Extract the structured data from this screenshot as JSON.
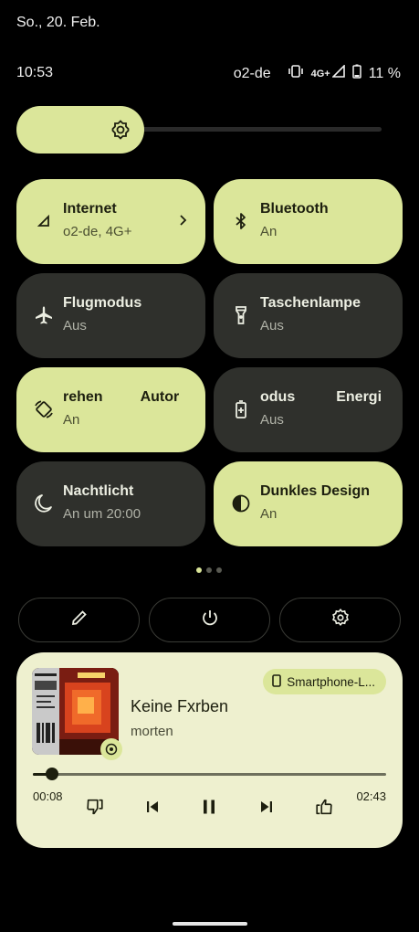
{
  "status_bar": {
    "date": "So., 20. Feb.",
    "time": "10:53",
    "carrier": "o2-de",
    "network": "4G+",
    "battery": "11 %"
  },
  "brightness": {
    "level": 0.35,
    "icon": "brightness-icon"
  },
  "tiles": [
    {
      "title": "Internet",
      "subtitle": "o2-de, 4G+",
      "state": "on",
      "icon": "signal-icon",
      "has_chevron": true
    },
    {
      "title": "Bluetooth",
      "subtitle": "An",
      "state": "on",
      "icon": "bluetooth-icon"
    },
    {
      "title": "Flugmodus",
      "subtitle": "Aus",
      "state": "off",
      "icon": "airplane-icon"
    },
    {
      "title": "Taschenlampe",
      "subtitle": "Aus",
      "state": "off",
      "icon": "flashlight-icon"
    },
    {
      "title": "Automatisch drehen",
      "title_visible_a": "rehen",
      "title_visible_b": "Autor",
      "subtitle": "An",
      "state": "on",
      "icon": "auto-rotate-icon"
    },
    {
      "title": "Energiesparmodus",
      "title_visible_a": "odus",
      "title_visible_b": "Energi",
      "subtitle": "Aus",
      "state": "off",
      "icon": "battery-saver-icon"
    },
    {
      "title": "Nachtlicht",
      "subtitle": "An um 20:00",
      "state": "off",
      "icon": "moon-icon"
    },
    {
      "title": "Dunkles Design",
      "subtitle": "An",
      "state": "on",
      "icon": "contrast-icon"
    }
  ],
  "page_indicator": {
    "pages": 3,
    "current": 1
  },
  "footer_buttons": [
    "edit-icon",
    "power-icon",
    "settings-icon"
  ],
  "media": {
    "device": "Smartphone-L...",
    "title": "Keine Fxrben",
    "artist": "morten",
    "elapsed": "00:08",
    "total": "02:43",
    "progress": 0.055
  },
  "colors": {
    "accent": "#dbe69a",
    "tile_off": "#2f302c",
    "media_bg": "#eef0cf",
    "background": "#000000"
  }
}
